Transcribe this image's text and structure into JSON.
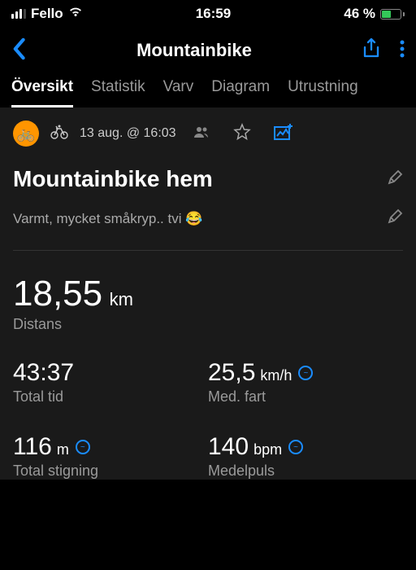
{
  "status": {
    "carrier": "Fello",
    "time": "16:59",
    "battery_pct": "46 %"
  },
  "header": {
    "title": "Mountainbike"
  },
  "tabs": [
    {
      "label": "Översikt",
      "active": true
    },
    {
      "label": "Statistik",
      "active": false
    },
    {
      "label": "Varv",
      "active": false
    },
    {
      "label": "Diagram",
      "active": false
    },
    {
      "label": "Utrustning",
      "active": false
    }
  ],
  "activity": {
    "sport_emoji": "🚲",
    "datetime": "13 aug. @ 16:03",
    "title": "Mountainbike hem",
    "note": "Varmt, mycket småkryp.. tvi 😂"
  },
  "stats": {
    "distance": {
      "value": "18,55",
      "unit": "km",
      "label": "Distans"
    },
    "total_time": {
      "value": "43:37",
      "label": "Total tid"
    },
    "avg_speed": {
      "value": "25,5",
      "unit": "km/h",
      "label": "Med. fart"
    },
    "elevation": {
      "value": "116",
      "unit": "m",
      "label": "Total stigning"
    },
    "avg_hr": {
      "value": "140",
      "unit": "bpm",
      "label": "Medelpuls"
    }
  }
}
